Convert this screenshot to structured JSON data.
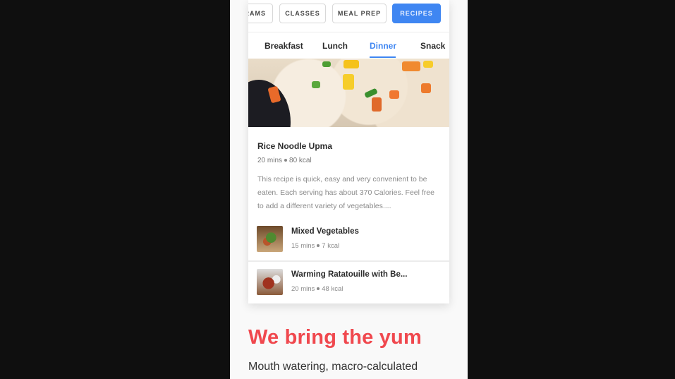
{
  "nav_chips": [
    {
      "label": "RAMS",
      "active": false
    },
    {
      "label": "CLASSES",
      "active": false
    },
    {
      "label": "MEAL PREP",
      "active": false
    },
    {
      "label": "RECIPES",
      "active": true
    }
  ],
  "meal_tabs": [
    {
      "label": "Breakfast",
      "active": false
    },
    {
      "label": "Lunch",
      "active": false
    },
    {
      "label": "Dinner",
      "active": true
    },
    {
      "label": "Snack",
      "active": false
    }
  ],
  "featured_recipe": {
    "image": "rice-noodle-upma-photo",
    "title": "Rice Noodle Upma",
    "time": "20 mins",
    "calories": "80 kcal",
    "description": "This recipe is quick, easy and very convenient to be eaten. Each serving has about 370 Calories. Feel free to add a different variety of vegetables...."
  },
  "recipe_list": [
    {
      "thumb": "mixed-vegetables-photo",
      "title": "Mixed Vegetables",
      "time": "15 mins",
      "calories": "7 kcal"
    },
    {
      "thumb": "ratatouille-photo",
      "title": "Warming Ratatouille with Be...",
      "time": "20 mins",
      "calories": "48 kcal"
    }
  ],
  "headline": "We bring the yum",
  "subheadline": "Mouth watering, macro-calculated",
  "colors": {
    "accent_blue": "#3f86f2",
    "headline_red": "#f0484e"
  }
}
